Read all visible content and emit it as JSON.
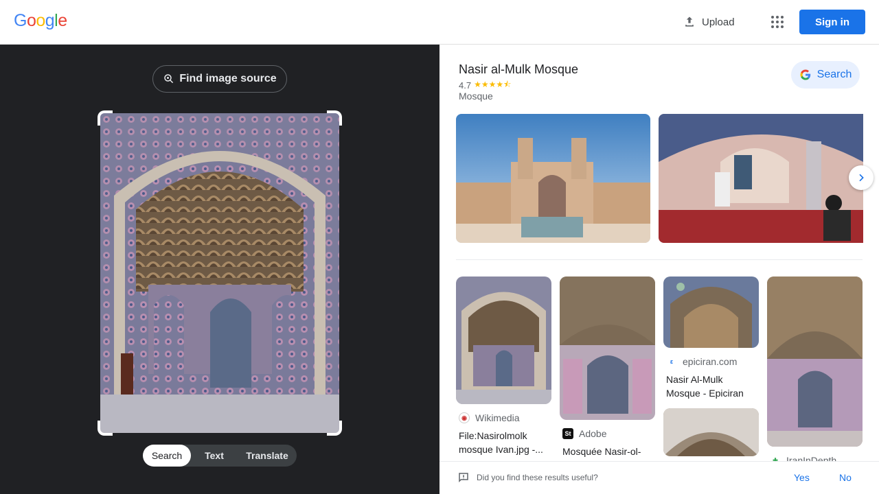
{
  "header": {
    "logo_letters": [
      "G",
      "o",
      "o",
      "g",
      "l",
      "e"
    ],
    "upload_label": "Upload",
    "signin_label": "Sign in"
  },
  "lens": {
    "find_source_label": "Find image source",
    "modes": [
      "Search",
      "Text",
      "Translate"
    ],
    "active_mode": "Search"
  },
  "knowledge_panel": {
    "title": "Nasir al-Mulk Mosque",
    "rating": "4.7",
    "rating_value": 4.7,
    "type": "Mosque",
    "search_label": "Search"
  },
  "results": [
    {
      "source": "Wikimedia",
      "title": "File:Nasirolmolk mosque Ivan.jpg -..."
    },
    {
      "source": "Adobe",
      "title": "Mosquée Nasir-ol-"
    },
    {
      "source": "epiciran.com",
      "title": "Nasir Al-Mulk Mosque - Epiciran"
    },
    {
      "source": "IranInDepth",
      "title": ""
    }
  ],
  "feedback": {
    "question": "Did you find these results useful?",
    "yes": "Yes",
    "no": "No"
  },
  "colors": {
    "accent": "#1a73e8",
    "dark_bg": "#202124",
    "star": "#fbbc04"
  }
}
